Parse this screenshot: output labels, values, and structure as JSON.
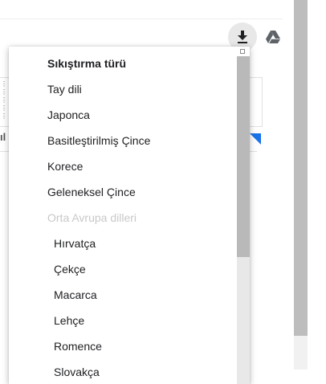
{
  "page": {
    "partial_label": "ıl"
  },
  "toolbar": {
    "download_icon": "download-icon",
    "drive_icon": "google-drive-icon"
  },
  "menu": {
    "items": [
      {
        "label": "Sıkıştırma türü",
        "state": "selected",
        "level": 1
      },
      {
        "label": "Tay dili",
        "state": "normal",
        "level": 1
      },
      {
        "label": "Japonca",
        "state": "normal",
        "level": 1
      },
      {
        "label": "Basitleştirilmiş Çince",
        "state": "normal",
        "level": 1
      },
      {
        "label": "Korece",
        "state": "normal",
        "level": 1
      },
      {
        "label": "Geleneksel Çince",
        "state": "normal",
        "level": 1
      },
      {
        "label": "Orta Avrupa dilleri",
        "state": "disabled",
        "level": 1
      },
      {
        "label": "Hırvatça",
        "state": "normal",
        "level": 2
      },
      {
        "label": "Çekçe",
        "state": "normal",
        "level": 2
      },
      {
        "label": "Macarca",
        "state": "normal",
        "level": 2
      },
      {
        "label": "Lehçe",
        "state": "normal",
        "level": 2
      },
      {
        "label": "Romence",
        "state": "normal",
        "level": 2
      },
      {
        "label": "Slovakça",
        "state": "normal",
        "level": 2
      }
    ]
  },
  "colors": {
    "accent": "#1a73e8",
    "disabled_text": "#c8c8c8",
    "scroll_thumb": "#b9b9b9"
  }
}
